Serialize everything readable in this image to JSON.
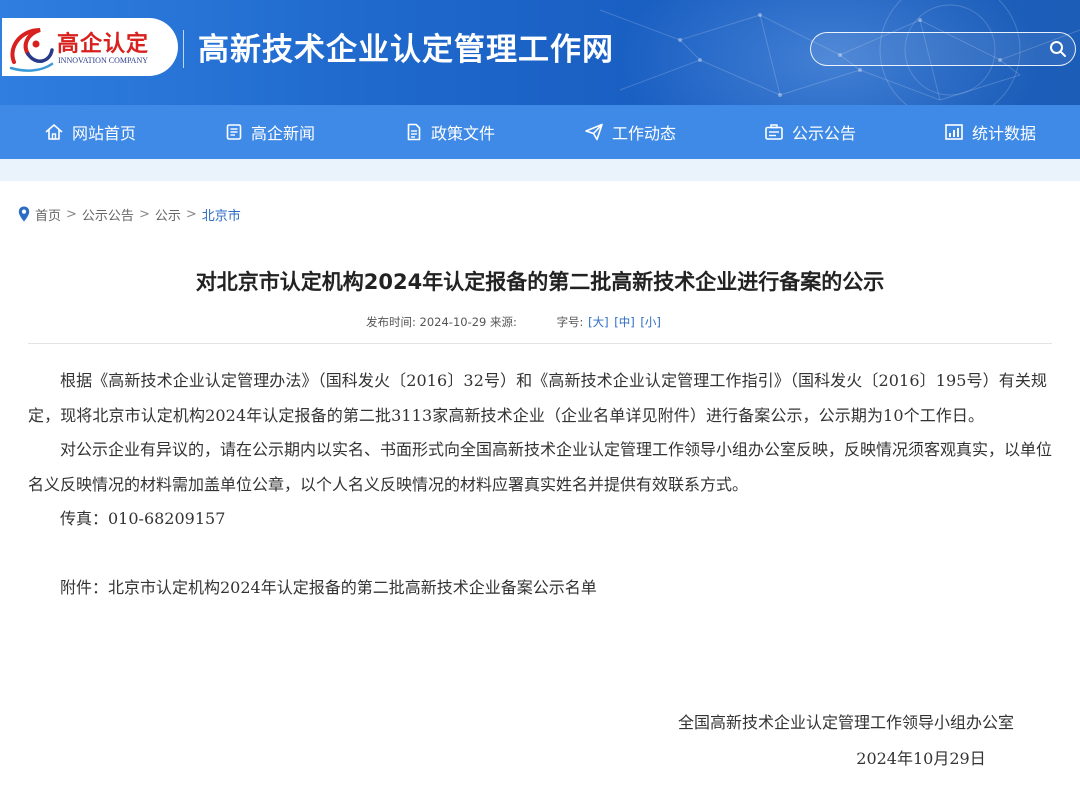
{
  "header": {
    "logo_cn": "高企认定",
    "logo_en": "INNOVATION COMPANY",
    "site_title": "高新技术企业认定管理工作网",
    "search_placeholder": ""
  },
  "nav": [
    {
      "label": "网站首页",
      "icon": "home-icon"
    },
    {
      "label": "高企新闻",
      "icon": "document-icon"
    },
    {
      "label": "政策文件",
      "icon": "file-icon"
    },
    {
      "label": "工作动态",
      "icon": "send-icon"
    },
    {
      "label": "公示公告",
      "icon": "bulletin-icon"
    },
    {
      "label": "统计数据",
      "icon": "stats-icon"
    }
  ],
  "breadcrumb": {
    "items": [
      "首页",
      "公示公告",
      "公示"
    ],
    "current": "北京市",
    "separator": ">"
  },
  "article": {
    "title": "对北京市认定机构2024年认定报备的第二批高新技术企业进行备案的公示",
    "published_label": "发布时间: 2024-10-29 来源:",
    "font_size_label": "字号:",
    "font_sizes": [
      "[大]",
      "[中]",
      "[小]"
    ],
    "paragraphs": [
      "根据《高新技术企业认定管理办法》（国科发火〔2016〕32号）和《高新技术企业认定管理工作指引》（国科发火〔2016〕195号）有关规定，现将北京市认定机构2024年认定报备的第二批3113家高新技术企业（企业名单详见附件）进行备案公示，公示期为10个工作日。",
      "对公示企业有异议的，请在公示期内以实名、书面形式向全国高新技术企业认定管理工作领导小组办公室反映，反映情况须客观真实，以单位名义反映情况的材料需加盖单位公章，以个人名义反映情况的材料应署真实姓名并提供有效联系方式。",
      "传真：010-68209157"
    ],
    "attachment": "附件：北京市认定机构2024年认定报备的第二批高新技术企业备案公示名单",
    "signature_org": "全国高新技术企业认定管理工作领导小组办公室",
    "signature_date": "2024年10月29日"
  },
  "colors": {
    "header_blue": "#1f68cc",
    "nav_blue": "#3f8ae6",
    "link_blue": "#2b6cc4",
    "logo_red": "#d8201e"
  }
}
